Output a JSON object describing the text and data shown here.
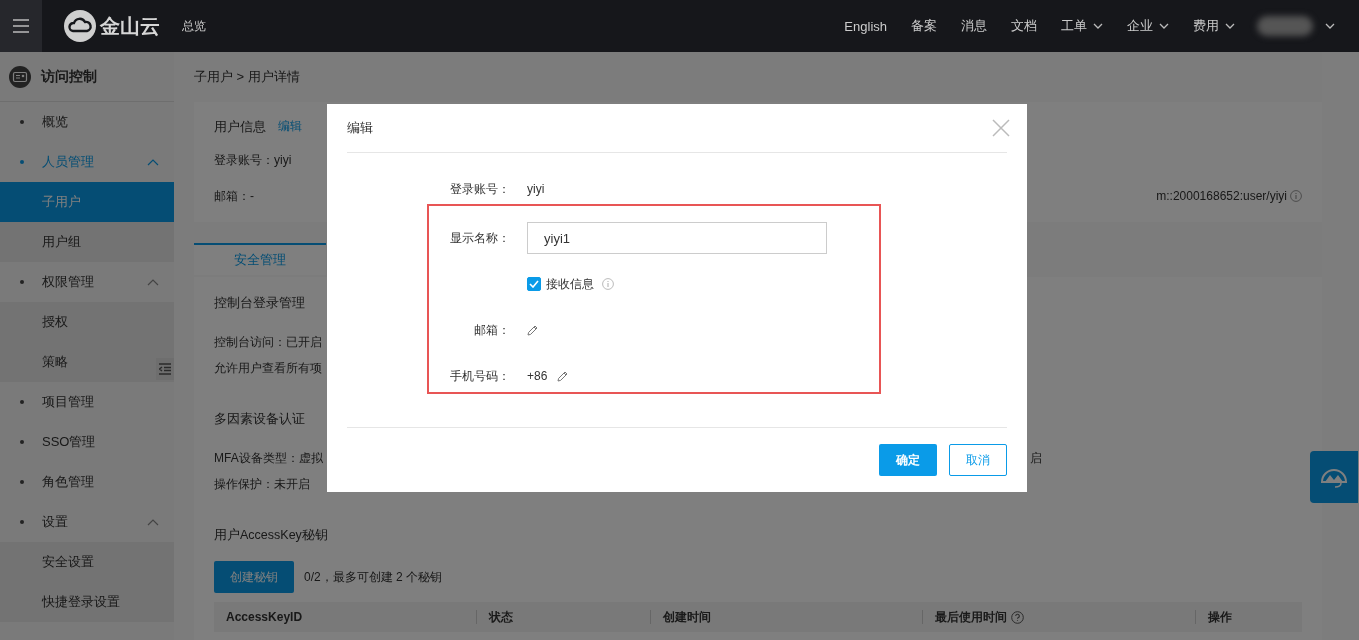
{
  "top_bar": {
    "brand": "金山云",
    "home_link": "总览",
    "links": [
      {
        "label": "English",
        "dropdown": false
      },
      {
        "label": "备案",
        "dropdown": false
      },
      {
        "label": "消息",
        "dropdown": false
      },
      {
        "label": "文档",
        "dropdown": false
      },
      {
        "label": "工单",
        "dropdown": true
      },
      {
        "label": "企业",
        "dropdown": true
      },
      {
        "label": "费用",
        "dropdown": true
      }
    ]
  },
  "sidebar": {
    "title": "访问控制",
    "items": [
      {
        "label": "概览",
        "selected": false
      },
      {
        "label": "人员管理",
        "selected": true,
        "expanded": true,
        "children": [
          {
            "label": "子用户",
            "selected": true
          },
          {
            "label": "用户组",
            "selected": false
          }
        ]
      },
      {
        "label": "权限管理",
        "selected": false,
        "expanded": true,
        "children": [
          {
            "label": "授权",
            "selected": false
          },
          {
            "label": "策略",
            "selected": false
          }
        ]
      },
      {
        "label": "项目管理",
        "selected": false
      },
      {
        "label": "SSO管理",
        "selected": false
      },
      {
        "label": "角色管理",
        "selected": false
      },
      {
        "label": "设置",
        "selected": false,
        "expanded": true,
        "children": [
          {
            "label": "安全设置",
            "selected": false
          },
          {
            "label": "快捷登录设置",
            "selected": false
          }
        ]
      }
    ]
  },
  "breadcrumb": "子用户 > 用户详情",
  "user_info": {
    "title": "用户信息",
    "edit_link": "编辑",
    "fields": [
      "登录账号：yiyi",
      "邮箱：-"
    ],
    "arn": "m::2000168652:user/yiyi"
  },
  "tabs": [
    {
      "label": "安全管理",
      "selected": true
    }
  ],
  "security": {
    "lines": [
      {
        "kind": "heading",
        "text": "控制台登录管理"
      },
      {
        "kind": "text",
        "text": "控制台访问：已开启"
      },
      {
        "kind": "text",
        "text": "允许用户查看所有项"
      },
      {
        "kind": "heading",
        "text": "多因素设备认证"
      },
      {
        "kind": "text",
        "text": "MFA设备类型：虚拟",
        "aside": "启"
      },
      {
        "kind": "text",
        "text": "操作保护：未开启"
      },
      {
        "kind": "heading",
        "text": "用户AccessKey秘钥"
      }
    ],
    "create_button": "创建秘钥",
    "key_note": "0/2，最多可创建 2 个秘钥",
    "columns": [
      {
        "label": "AccessKeyID",
        "help": false
      },
      {
        "label": "状态",
        "help": false
      },
      {
        "label": "创建时间",
        "help": false
      },
      {
        "label": "最后使用时间",
        "help": true
      },
      {
        "label": "操作",
        "help": false
      }
    ]
  },
  "modal": {
    "title": "编辑",
    "fields": [
      {
        "kind": "text",
        "label": "登录账号：",
        "value": "yiyi"
      }
    ],
    "highlighted_fields": [
      {
        "kind": "input",
        "label": "显示名称：",
        "value": "yiyi1"
      },
      {
        "kind": "checkbox",
        "label": "接收信息",
        "checked": true
      },
      {
        "kind": "edit",
        "label": "邮箱："
      },
      {
        "kind": "edit",
        "label": "手机号码：",
        "value": "+86"
      }
    ],
    "buttons": [
      {
        "label": "确定",
        "kind": "primary"
      },
      {
        "label": "取消",
        "kind": "secondary"
      }
    ]
  }
}
